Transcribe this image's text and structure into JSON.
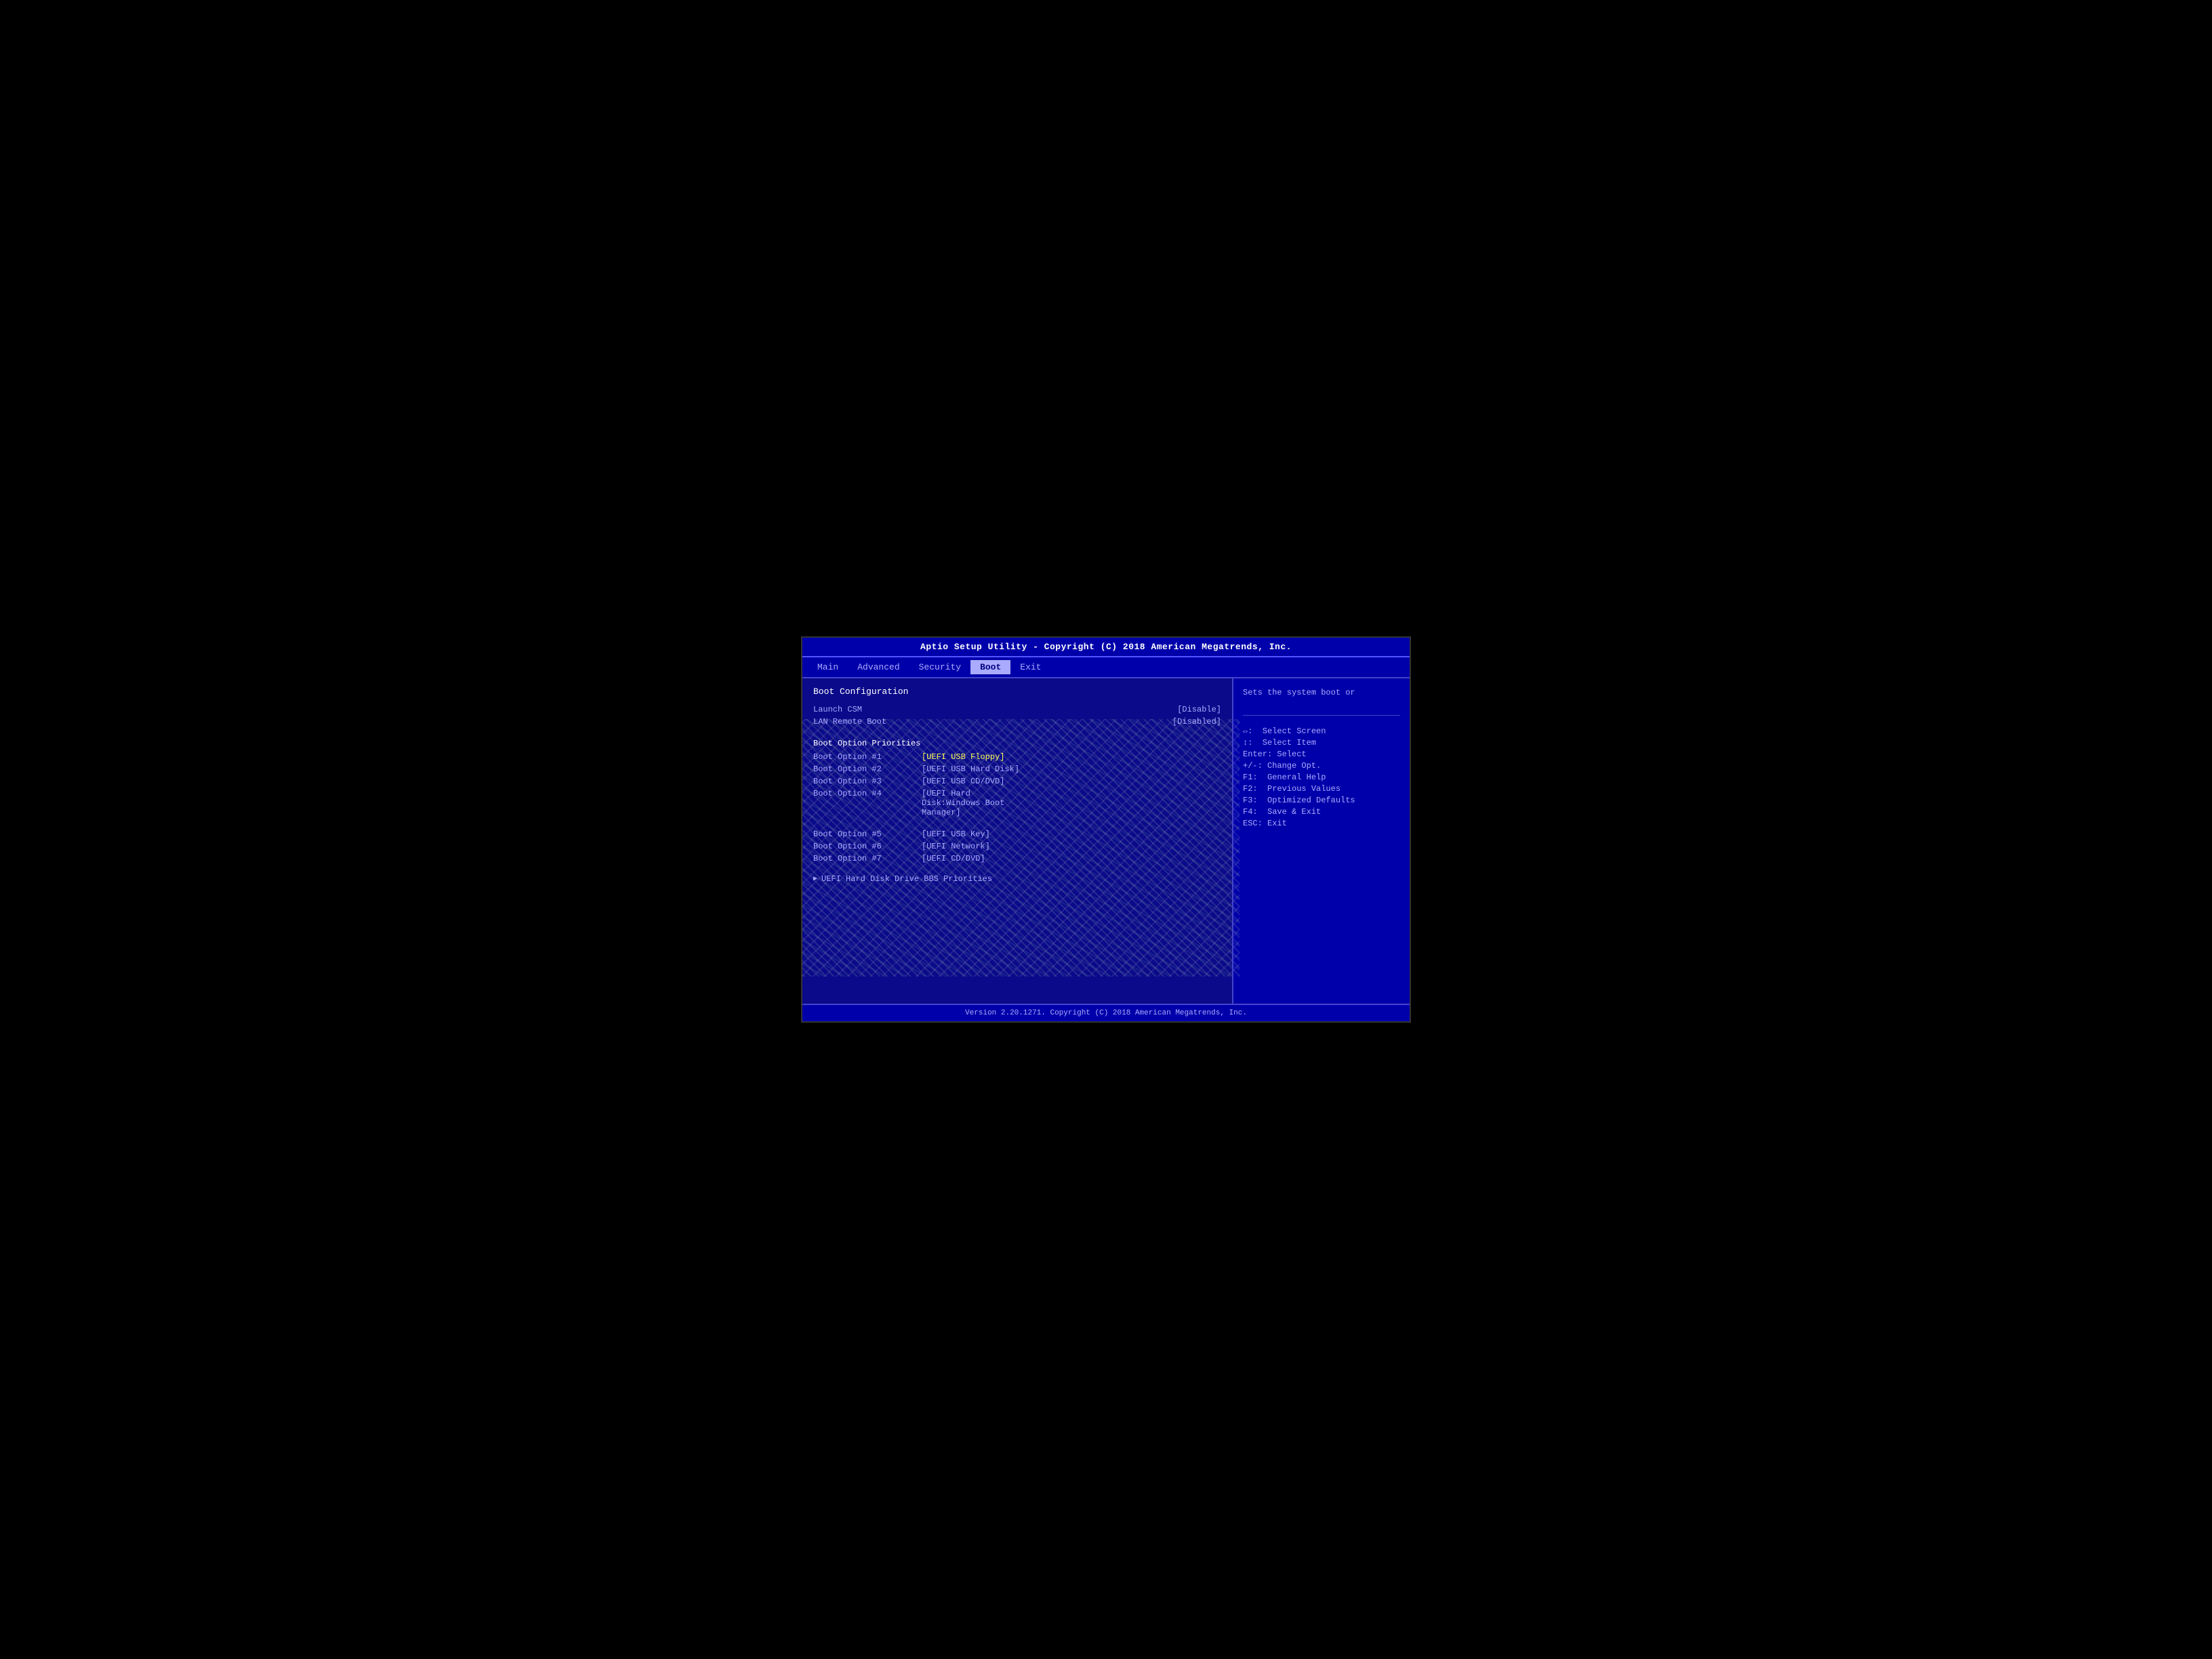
{
  "header": {
    "title": "Aptio Setup Utility - Copyright (C) 2018 American Megatrends, Inc."
  },
  "nav": {
    "items": [
      {
        "label": "Main",
        "active": false
      },
      {
        "label": "Advanced",
        "active": false
      },
      {
        "label": "Security",
        "active": false
      },
      {
        "label": "Boot",
        "active": true
      },
      {
        "label": "Exit",
        "active": false
      }
    ]
  },
  "main": {
    "section_title": "Boot Configuration",
    "launch_csm_label": "Launch CSM",
    "launch_csm_value": "[Disable]",
    "lan_remote_boot_label": "LAN Remote Boot",
    "lan_remote_boot_value": "[Disabled]",
    "boot_priorities_title": "Boot Option Priorities",
    "boot_options": [
      {
        "label": "Boot Option #1",
        "value": "[UEFI USB Floppy]",
        "selected": true
      },
      {
        "label": "Boot Option #2",
        "value": "[UEFI USB Hard Disk]",
        "selected": false
      },
      {
        "label": "Boot Option #3",
        "value": "[UEFI USB CD/DVD]",
        "selected": false
      },
      {
        "label": "Boot Option #4",
        "value": "[UEFI Hard Disk:Windows Boot Manager]",
        "selected": false
      },
      {
        "label": "Boot Option #5",
        "value": "[UEFI USB Key]",
        "selected": false
      },
      {
        "label": "Boot Option #6",
        "value": "[UEFI Network]",
        "selected": false
      },
      {
        "label": "Boot Option #7",
        "value": "[UEFI CD/DVD]",
        "selected": false
      }
    ],
    "bbs_label": "UEFI Hard Disk Drive BBS Priorities"
  },
  "help": {
    "description": "Sets the system boot or",
    "keys": [
      {
        "key": "↔:",
        "action": "Select Screen"
      },
      {
        "key": "↕:",
        "action": "Select Item"
      },
      {
        "key": "Enter:",
        "action": "Select"
      },
      {
        "key": "+/-:",
        "action": "Change Opt."
      },
      {
        "key": "F1:",
        "action": "General Help"
      },
      {
        "key": "F2:",
        "action": "Previous Values"
      },
      {
        "key": "F3:",
        "action": "Optimized Defaults"
      },
      {
        "key": "F4:",
        "action": "Save & Exit"
      },
      {
        "key": "ESC:",
        "action": "Exit"
      }
    ]
  },
  "footer": {
    "text": "Version 2.20.1271. Copyright (C) 2018 American Megatrends, Inc."
  }
}
